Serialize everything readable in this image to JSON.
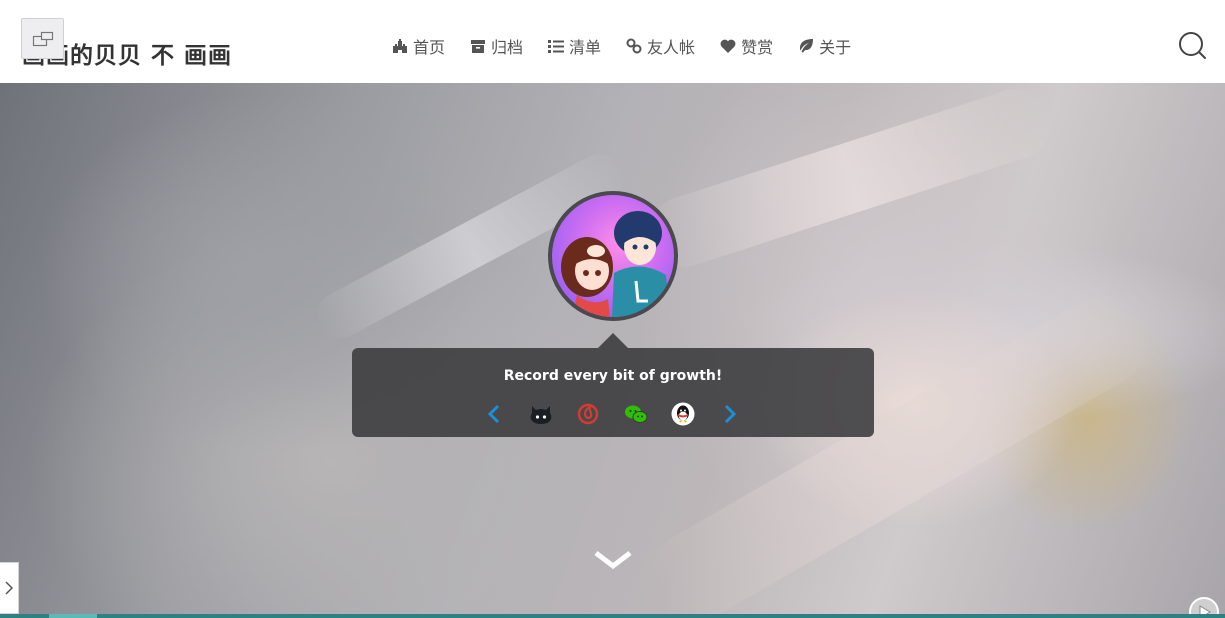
{
  "header": {
    "site_title": "画画的贝贝 不 画画",
    "nav": [
      {
        "label": "首页",
        "icon": "castle-icon"
      },
      {
        "label": "归档",
        "icon": "archive-icon"
      },
      {
        "label": "清单",
        "icon": "list-icon"
      },
      {
        "label": "友人帐",
        "icon": "link-icon"
      },
      {
        "label": "赞赏",
        "icon": "heart-icon"
      },
      {
        "label": "关于",
        "icon": "leaf-icon"
      }
    ],
    "search_icon": "search-icon"
  },
  "hero": {
    "tagline": "Record every bit of growth!",
    "social": [
      "github-icon",
      "netease-music-icon",
      "wechat-icon",
      "qq-icon"
    ],
    "prev_icon": "chevron-left-icon",
    "next_icon": "chevron-right-icon",
    "scroll_icon": "chevron-down-icon"
  },
  "colors": {
    "accent": "#1e8fd6",
    "nav_text": "#555555",
    "card_bg": "#3a3a3c",
    "progress": "#2f7f84",
    "github": "#1b1f23",
    "netease": "#d43c33",
    "wechat": "#2dc100"
  },
  "player": {
    "progress_fraction": 0.08
  }
}
